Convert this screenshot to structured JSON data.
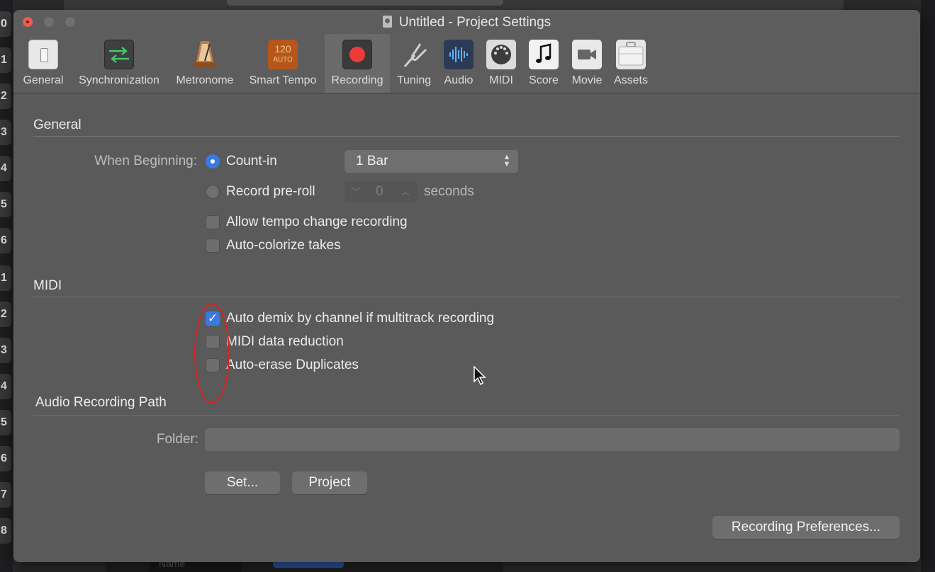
{
  "window": {
    "title": "Untitled - Project Settings"
  },
  "toolbar": {
    "items": [
      {
        "label": "General",
        "icon": "general-switch-icon"
      },
      {
        "label": "Synchronization",
        "icon": "sync-arrows-icon"
      },
      {
        "label": "Metronome",
        "icon": "metronome-icon"
      },
      {
        "label": "Smart Tempo",
        "icon": "smart-tempo-icon",
        "icon_text": "120",
        "icon_subtext": "AUTO"
      },
      {
        "label": "Recording",
        "icon": "record-icon",
        "selected": true
      },
      {
        "label": "Tuning",
        "icon": "tuning-fork-icon"
      },
      {
        "label": "Audio",
        "icon": "waveform-icon"
      },
      {
        "label": "MIDI",
        "icon": "midi-port-icon"
      },
      {
        "label": "Score",
        "icon": "music-note-icon"
      },
      {
        "label": "Movie",
        "icon": "video-camera-icon"
      },
      {
        "label": "Assets",
        "icon": "briefcase-icon"
      }
    ]
  },
  "general": {
    "heading": "General",
    "when_beginning_label": "When Beginning:",
    "count_in": {
      "label": "Count-in",
      "selected": true,
      "value": "1 Bar"
    },
    "pre_roll": {
      "label": "Record pre-roll",
      "selected": false,
      "value": "0",
      "unit": "seconds"
    },
    "allow_tempo": {
      "label": "Allow tempo change recording",
      "checked": false
    },
    "auto_colorize": {
      "label": "Auto-colorize takes",
      "checked": false
    }
  },
  "midi": {
    "heading": "MIDI",
    "auto_demix": {
      "label": "Auto demix by channel if multitrack recording",
      "checked": true
    },
    "data_reduction": {
      "label": "MIDI data reduction",
      "checked": false
    },
    "auto_erase": {
      "label": "Auto-erase Duplicates",
      "checked": false
    }
  },
  "audio_path": {
    "heading": "Audio Recording Path",
    "folder_label": "Folder:",
    "folder_value": "",
    "set_button": "Set...",
    "project_button": "Project"
  },
  "footer": {
    "prefs_button": "Recording Preferences..."
  },
  "background": {
    "side_numbers": [
      "0",
      "1",
      "2",
      "3",
      "4",
      "5",
      "6",
      "1",
      "2",
      "3",
      "4",
      "5",
      "6",
      "7",
      "8"
    ],
    "bottom_name": "Name"
  },
  "colors": {
    "accent": "#3a79e0",
    "record_red": "#f03a3a",
    "annotation": "#e01e1e"
  }
}
